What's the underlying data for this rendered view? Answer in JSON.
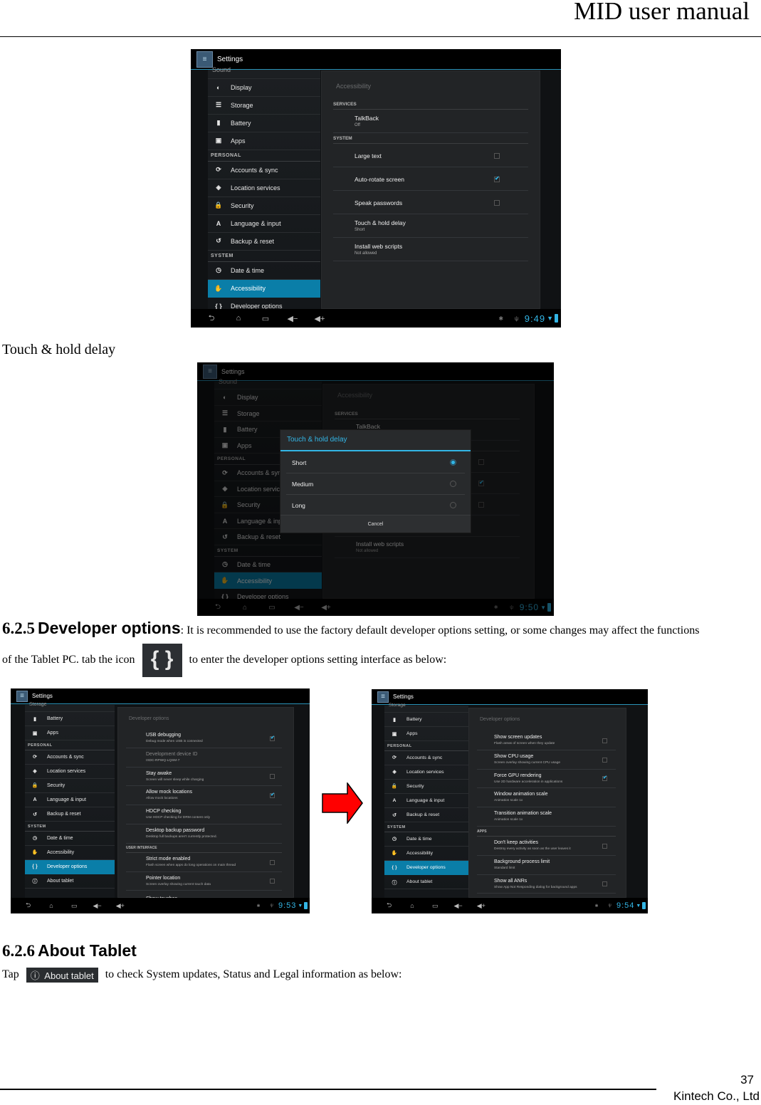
{
  "header": {
    "title": "MID user manual"
  },
  "footer": {
    "page_number": "37",
    "company": "Kintech Co., Ltd"
  },
  "caption_touch_hold": "Touch & hold delay",
  "section_625": {
    "number": "6.2.5",
    "title": "Developer options",
    "text1": ": It is recommended to use the factory default developer options setting, or some changes may affect the functions",
    "text2_before": "of the Tablet PC. tab the icon",
    "icon_glyph": "{ }",
    "text2_after": "to enter the developer options setting interface as below:"
  },
  "section_626": {
    "number": "6.2.6",
    "title": "About Tablet",
    "text_before": "Tap",
    "button_icon": "ⓘ",
    "button_label": "About tablet",
    "text_after": "to check System updates, Status and Legal information as below:"
  },
  "colors": {
    "accent": "#33b5e5",
    "selected": "#0a7ea8",
    "arrow": "#ff0000"
  },
  "screen1": {
    "app_title": "Settings",
    "clipped_top": "Sound",
    "nav": [
      {
        "type": "item",
        "icon": "display-icon",
        "glyph": "◐",
        "label": "Display"
      },
      {
        "type": "item",
        "icon": "storage-icon",
        "glyph": "☰",
        "label": "Storage"
      },
      {
        "type": "item",
        "icon": "battery-icon",
        "glyph": "▮",
        "label": "Battery"
      },
      {
        "type": "item",
        "icon": "apps-icon",
        "glyph": "▣",
        "label": "Apps"
      },
      {
        "type": "section",
        "label": "PERSONAL"
      },
      {
        "type": "item",
        "icon": "sync-icon",
        "glyph": "⟳",
        "label": "Accounts & sync"
      },
      {
        "type": "item",
        "icon": "location-icon",
        "glyph": "◈",
        "label": "Location services"
      },
      {
        "type": "item",
        "icon": "lock-icon",
        "glyph": "🔒",
        "label": "Security"
      },
      {
        "type": "item",
        "icon": "language-icon",
        "glyph": "A",
        "label": "Language & input"
      },
      {
        "type": "item",
        "icon": "backup-icon",
        "glyph": "↺",
        "label": "Backup & reset"
      },
      {
        "type": "section",
        "label": "SYSTEM"
      },
      {
        "type": "item",
        "icon": "clock-icon",
        "glyph": "◷",
        "label": "Date & time"
      },
      {
        "type": "item",
        "icon": "hand-icon",
        "glyph": "✋",
        "label": "Accessibility",
        "selected": true
      },
      {
        "type": "item",
        "icon": "braces-icon",
        "glyph": "{ }",
        "label": "Developer options"
      }
    ],
    "panel_title": "Accessibility",
    "panel": [
      {
        "type": "section",
        "label": "SERVICES"
      },
      {
        "type": "pref",
        "title": "TalkBack",
        "summary": "Off"
      },
      {
        "type": "section",
        "label": "SYSTEM"
      },
      {
        "type": "pref",
        "title": "Large text",
        "checkbox": false
      },
      {
        "type": "pref",
        "title": "Auto-rotate screen",
        "checkbox": true
      },
      {
        "type": "pref",
        "title": "Speak passwords",
        "checkbox": false
      },
      {
        "type": "pref",
        "title": "Touch & hold delay",
        "summary": "Short"
      },
      {
        "type": "pref",
        "title": "Install web scripts",
        "summary": "Not allowed"
      }
    ],
    "clock": "9:49"
  },
  "screen2": {
    "app_title": "Settings",
    "clock": "9:50",
    "dialog": {
      "title": "Touch & hold delay",
      "options": [
        {
          "label": "Short",
          "selected": true
        },
        {
          "label": "Medium",
          "selected": false
        },
        {
          "label": "Long",
          "selected": false
        }
      ],
      "cancel": "Cancel"
    }
  },
  "screen3": {
    "app_title": "Settings",
    "clipped_top": "Storage",
    "nav": [
      {
        "type": "item",
        "icon": "battery-icon",
        "glyph": "▮",
        "label": "Battery"
      },
      {
        "type": "item",
        "icon": "apps-icon",
        "glyph": "▣",
        "label": "Apps"
      },
      {
        "type": "section",
        "label": "PERSONAL"
      },
      {
        "type": "item",
        "icon": "sync-icon",
        "glyph": "⟳",
        "label": "Accounts & sync"
      },
      {
        "type": "item",
        "icon": "location-icon",
        "glyph": "◈",
        "label": "Location services"
      },
      {
        "type": "item",
        "icon": "lock-icon",
        "glyph": "🔒",
        "label": "Security"
      },
      {
        "type": "item",
        "icon": "language-icon",
        "glyph": "A",
        "label": "Language & input"
      },
      {
        "type": "item",
        "icon": "backup-icon",
        "glyph": "↺",
        "label": "Backup & reset"
      },
      {
        "type": "section",
        "label": "SYSTEM"
      },
      {
        "type": "item",
        "icon": "clock-icon",
        "glyph": "◷",
        "label": "Date & time"
      },
      {
        "type": "item",
        "icon": "hand-icon",
        "glyph": "✋",
        "label": "Accessibility"
      },
      {
        "type": "item",
        "icon": "braces-icon",
        "glyph": "{ }",
        "label": "Developer options",
        "selected": true
      },
      {
        "type": "item",
        "icon": "info-icon",
        "glyph": "ⓘ",
        "label": "About tablet"
      }
    ],
    "panel_title": "Developer options",
    "panel": [
      {
        "type": "pref",
        "title": "USB debugging",
        "summary": "Debug mode when USB is connected",
        "checkbox": true
      },
      {
        "type": "pref",
        "title": "Development device ID",
        "summary": "IXDC-RPWQ-LQSM-7",
        "disabled": true
      },
      {
        "type": "pref",
        "title": "Stay awake",
        "summary": "Screen will never sleep while charging",
        "checkbox": false
      },
      {
        "type": "pref",
        "title": "Allow mock locations",
        "summary": "Allow mock locations",
        "checkbox": true
      },
      {
        "type": "pref",
        "title": "HDCP checking",
        "summary": "Use HDCP checking for DRM content only"
      },
      {
        "type": "pref",
        "title": "Desktop backup password",
        "summary": "Desktop full backups aren't currently protected."
      },
      {
        "type": "section",
        "label": "USER INTERFACE"
      },
      {
        "type": "pref",
        "title": "Strict mode enabled",
        "summary": "Flash screen when apps do long operations on main thread",
        "checkbox": false
      },
      {
        "type": "pref",
        "title": "Pointer location",
        "summary": "Screen overlay showing current touch data",
        "checkbox": false
      },
      {
        "type": "pref",
        "title": "Show touches",
        "summary": ""
      }
    ],
    "clock": "9:53"
  },
  "screen4": {
    "app_title": "Settings",
    "panel_title": "Developer options",
    "panel": [
      {
        "type": "pref",
        "title": "Show screen updates",
        "summary": "Flash areas of screen when they update",
        "checkbox": false
      },
      {
        "type": "pref",
        "title": "Show CPU usage",
        "summary": "Screen overlay showing current CPU usage",
        "checkbox": false
      },
      {
        "type": "pref",
        "title": "Force GPU rendering",
        "summary": "Use 2D hardware acceleration in applications",
        "checkbox": true
      },
      {
        "type": "pref",
        "title": "Window animation scale",
        "summary": "Animation scale 1x"
      },
      {
        "type": "pref",
        "title": "Transition animation scale",
        "summary": "Animation scale 1x"
      },
      {
        "type": "section",
        "label": "APPS"
      },
      {
        "type": "pref",
        "title": "Don't keep activities",
        "summary": "Destroy every activity as soon as the user leaves it",
        "checkbox": false
      },
      {
        "type": "pref",
        "title": "Background process limit",
        "summary": "Standard limit"
      },
      {
        "type": "pref",
        "title": "Show all ANRs",
        "summary": "Show App Not Responding dialog for background apps",
        "checkbox": false
      }
    ],
    "clock": "9:54"
  },
  "navbar": {
    "back": "⮌",
    "home": "⌂",
    "recents": "▭",
    "vol_down": "◀−",
    "vol_up": "◀+",
    "debug": "✱",
    "usb": "ψ",
    "wifi": "◥"
  }
}
